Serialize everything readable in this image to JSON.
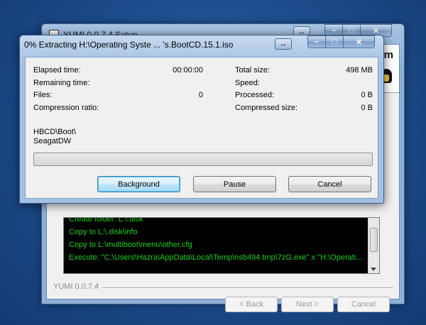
{
  "back_window": {
    "title": "YUMI 0.0.7.4 Setup",
    "logo_text": "m",
    "log_lines": [
      "Create folder: L:\\.disk",
      "Copy to L:\\.disk\\info",
      "Copy to L:\\multiboot\\menu\\other.cfg",
      "Execute: \"C:\\Users\\Hazra\\AppData\\Local\\Temp\\nsb494.tmp\\7zG.exe\" x \"H:\\Operati..."
    ],
    "brand": "YUMI 0.0.7.4",
    "buttons": {
      "back": "< Back",
      "next": "Next >",
      "cancel": "Cancel"
    }
  },
  "dialog": {
    "title": "0% Extracting H:\\Operating Syste ... 's.BootCD.15.1.iso",
    "stats_left": [
      {
        "label": "Elapsed time:",
        "value": "00:00:00"
      },
      {
        "label": "Remaining time:",
        "value": ""
      },
      {
        "label": "Files:",
        "value": "0"
      },
      {
        "label": "Compression ratio:",
        "value": ""
      }
    ],
    "stats_right": [
      {
        "label": "Total size:",
        "value": "498 MB"
      },
      {
        "label": "Speed:",
        "value": ""
      },
      {
        "label": "Processed:",
        "value": "0 B"
      },
      {
        "label": "Compressed size:",
        "value": "0 B"
      }
    ],
    "current_path_line1": "HBCD\\Boot\\",
    "current_path_line2": "SeagatDW",
    "progress": 0,
    "buttons": {
      "background": "Background",
      "pause": "Pause",
      "cancel": "Cancel"
    }
  },
  "icons": {
    "resize": "↔",
    "minimize": "–",
    "maximize": "□",
    "close": "✕"
  }
}
